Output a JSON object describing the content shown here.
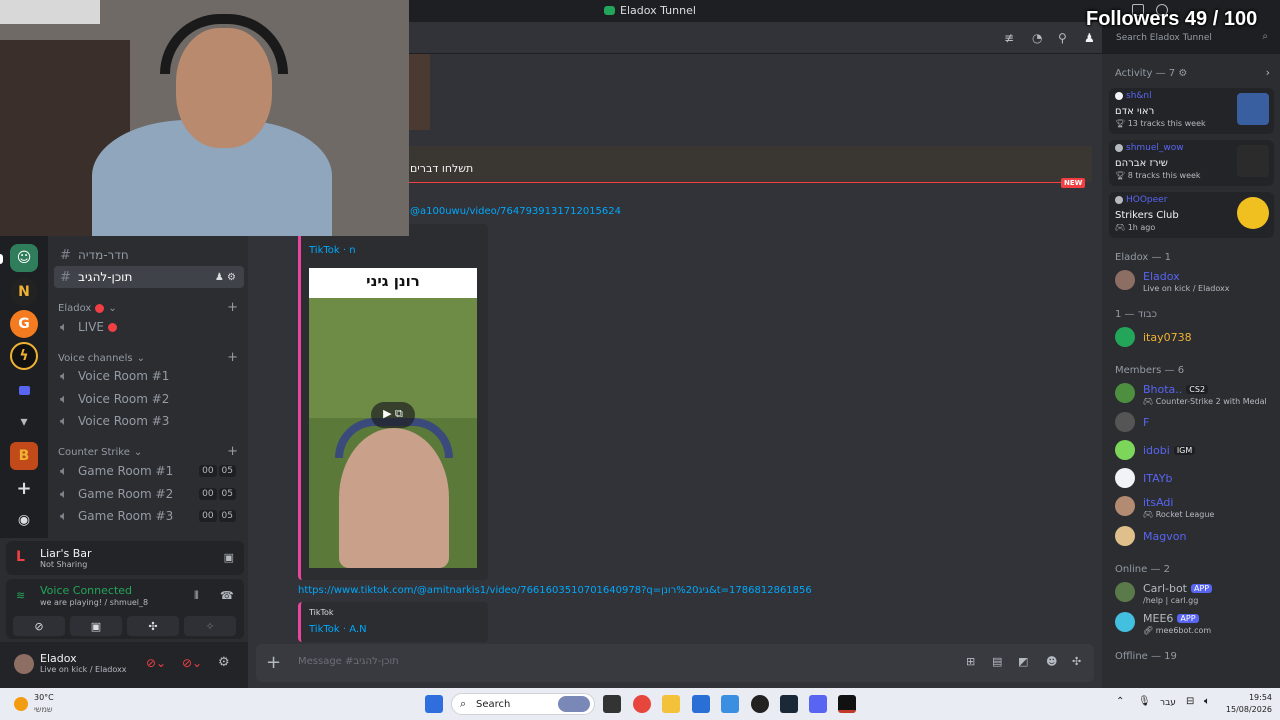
{
  "app": {
    "title": "Eladox Tunnel"
  },
  "overlay": {
    "followers": "Followers 49 / 100"
  },
  "search": {
    "placeholder": "Search Eladox Tunnel"
  },
  "sidebar": {
    "channels_top": [
      {
        "label": "חדר-מדיה",
        "active": false
      },
      {
        "label": "תוכן-להגיב",
        "active": true
      }
    ],
    "live_category": "Eladox",
    "live_channel": "LIVE",
    "voice_category": "Voice channels",
    "voice_rooms": [
      "Voice Room #1",
      "Voice Room #2",
      "Voice Room #3"
    ],
    "cs_category": "Counter Strike",
    "game_rooms": [
      {
        "label": "Game Room #1",
        "c1": "00",
        "c2": "05"
      },
      {
        "label": "Game Room #2",
        "c1": "00",
        "c2": "05"
      },
      {
        "label": "Game Room #3",
        "c1": "00",
        "c2": "05"
      }
    ]
  },
  "activity_panel": {
    "title": "Liar's Bar",
    "sub": "Not Sharing"
  },
  "voice_panel": {
    "title": "Voice Connected",
    "sub": "we are playing! / shmuel_8"
  },
  "user": {
    "name": "Eladox",
    "status": "Live on kick / Eladoxx"
  },
  "chat": {
    "pinned_text": "תשלחו דברים",
    "new_badge": "NEW",
    "link1": "@a100uwu/video/7647939131712015624",
    "embed1_provider": "TikTok · n",
    "video_caption": "רונן גיני",
    "link2": "https://www.tiktok.com/@amitnarkis1/video/7661603510701640978?q=גיג%20רונן&t=1786812861856",
    "embed2_source": "TikTok",
    "embed2_provider": "TikTok · A.N",
    "composer_placeholder": "Message #תוכן-להגיב"
  },
  "members": {
    "activity_header": "Activity — 7",
    "activity_cards": [
      {
        "name": "sh&nl",
        "title": "ראוי אדם",
        "sub": "13 tracks this week",
        "thumb_color": "#3a5fa0"
      },
      {
        "name": "shmuel_wow",
        "title": "שירז אברהם",
        "sub": "8 tracks this week",
        "thumb_color": "#2b2b2b"
      },
      {
        "name": "HOOpeer",
        "title": "Strikers Club",
        "sub": "1h ago",
        "thumb_color": "#1c1c1c"
      }
    ],
    "sections": [
      {
        "header": "Eladox — 1",
        "list": [
          {
            "name": "Eladox",
            "status": "Live on kick / Eladoxx",
            "color": "#5865f2",
            "av": "#8d6e63"
          }
        ]
      },
      {
        "header": "כבוד — 1",
        "list": [
          {
            "name": "itay0738",
            "status": "",
            "color": "#f0b232",
            "av": "#23a55a"
          }
        ]
      },
      {
        "header": "Members — 6",
        "list": [
          {
            "name": "Bhota..",
            "tag": "CS2",
            "status": "Counter-Strike 2 with Medal",
            "color": "#5865f2",
            "av": "#4e8f3f"
          },
          {
            "name": "F",
            "status": "",
            "color": "#5865f2",
            "av": "#555"
          },
          {
            "name": "idobi",
            "tag": "IGM",
            "status": "",
            "color": "#5865f2",
            "av": "#7cd65a"
          },
          {
            "name": "ITAYb",
            "status": "",
            "color": "#5865f2",
            "av": "#f2f3f5"
          },
          {
            "name": "itsAdi",
            "status": "Rocket League",
            "color": "#5865f2",
            "av": "#b38a72"
          },
          {
            "name": "Magvon",
            "status": "",
            "color": "#5865f2",
            "av": "#e0c08a"
          }
        ]
      },
      {
        "header": "Online — 2",
        "list": [
          {
            "name": "Carl-bot",
            "tag": "APP",
            "status": "/help | carl.gg",
            "color": "#b5bac1",
            "av": "#5b7a4a"
          },
          {
            "name": "MEE6",
            "tag": "APP",
            "status": "mee6bot.com",
            "color": "#b5bac1",
            "av": "#43c0e0"
          }
        ]
      }
    ],
    "offline_header": "Offline — 19"
  },
  "taskbar": {
    "weather_temp": "30°C",
    "weather_desc": "שמשי",
    "search_label": "Search",
    "lang": "עבר",
    "time": "19:54",
    "date": "15/08/2026"
  }
}
